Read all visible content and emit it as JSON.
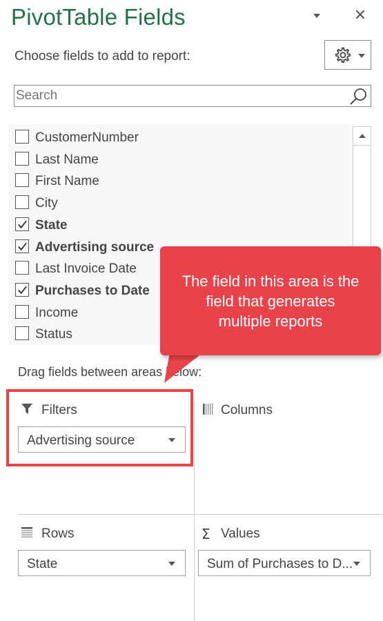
{
  "panel": {
    "title": "PivotTable Fields",
    "close_glyph": "×",
    "choose_label": "Choose fields to add to report:",
    "search_placeholder": "Search"
  },
  "fields": [
    {
      "label": "CustomerNumber",
      "checked": false,
      "bold": false
    },
    {
      "label": "Last Name",
      "checked": false,
      "bold": false
    },
    {
      "label": "First Name",
      "checked": false,
      "bold": false
    },
    {
      "label": "City",
      "checked": false,
      "bold": false
    },
    {
      "label": "State",
      "checked": true,
      "bold": true
    },
    {
      "label": "Advertising source",
      "checked": true,
      "bold": true
    },
    {
      "label": " Last Invoice Date",
      "checked": false,
      "bold": false
    },
    {
      "label": "Purchases to Date",
      "checked": true,
      "bold": true
    },
    {
      "label": "Income",
      "checked": false,
      "bold": false
    },
    {
      "label": "Status",
      "checked": false,
      "bold": false
    }
  ],
  "areas": {
    "drag_label": "Drag fields between areas below:",
    "filters": {
      "label": "Filters",
      "item": "Advertising source"
    },
    "columns": {
      "label": "Columns"
    },
    "rows": {
      "label": "Rows",
      "item": "State"
    },
    "values": {
      "label": "Values",
      "item": "Sum of Purchases to D..."
    }
  },
  "callout": {
    "line1": "The field in this area is the",
    "line2": "field that generates",
    "line3": "multiple reports"
  },
  "colors": {
    "title": "#217346",
    "callout": "#e8434a",
    "highlight": "#e8444a"
  },
  "icons": {
    "title_dropdown": "chevron-down-icon",
    "close": "close-icon",
    "settings": "gear-icon",
    "search": "search-icon",
    "filters": "filter-icon",
    "columns": "columns-icon",
    "rows": "rows-icon",
    "values": "sigma-icon"
  }
}
